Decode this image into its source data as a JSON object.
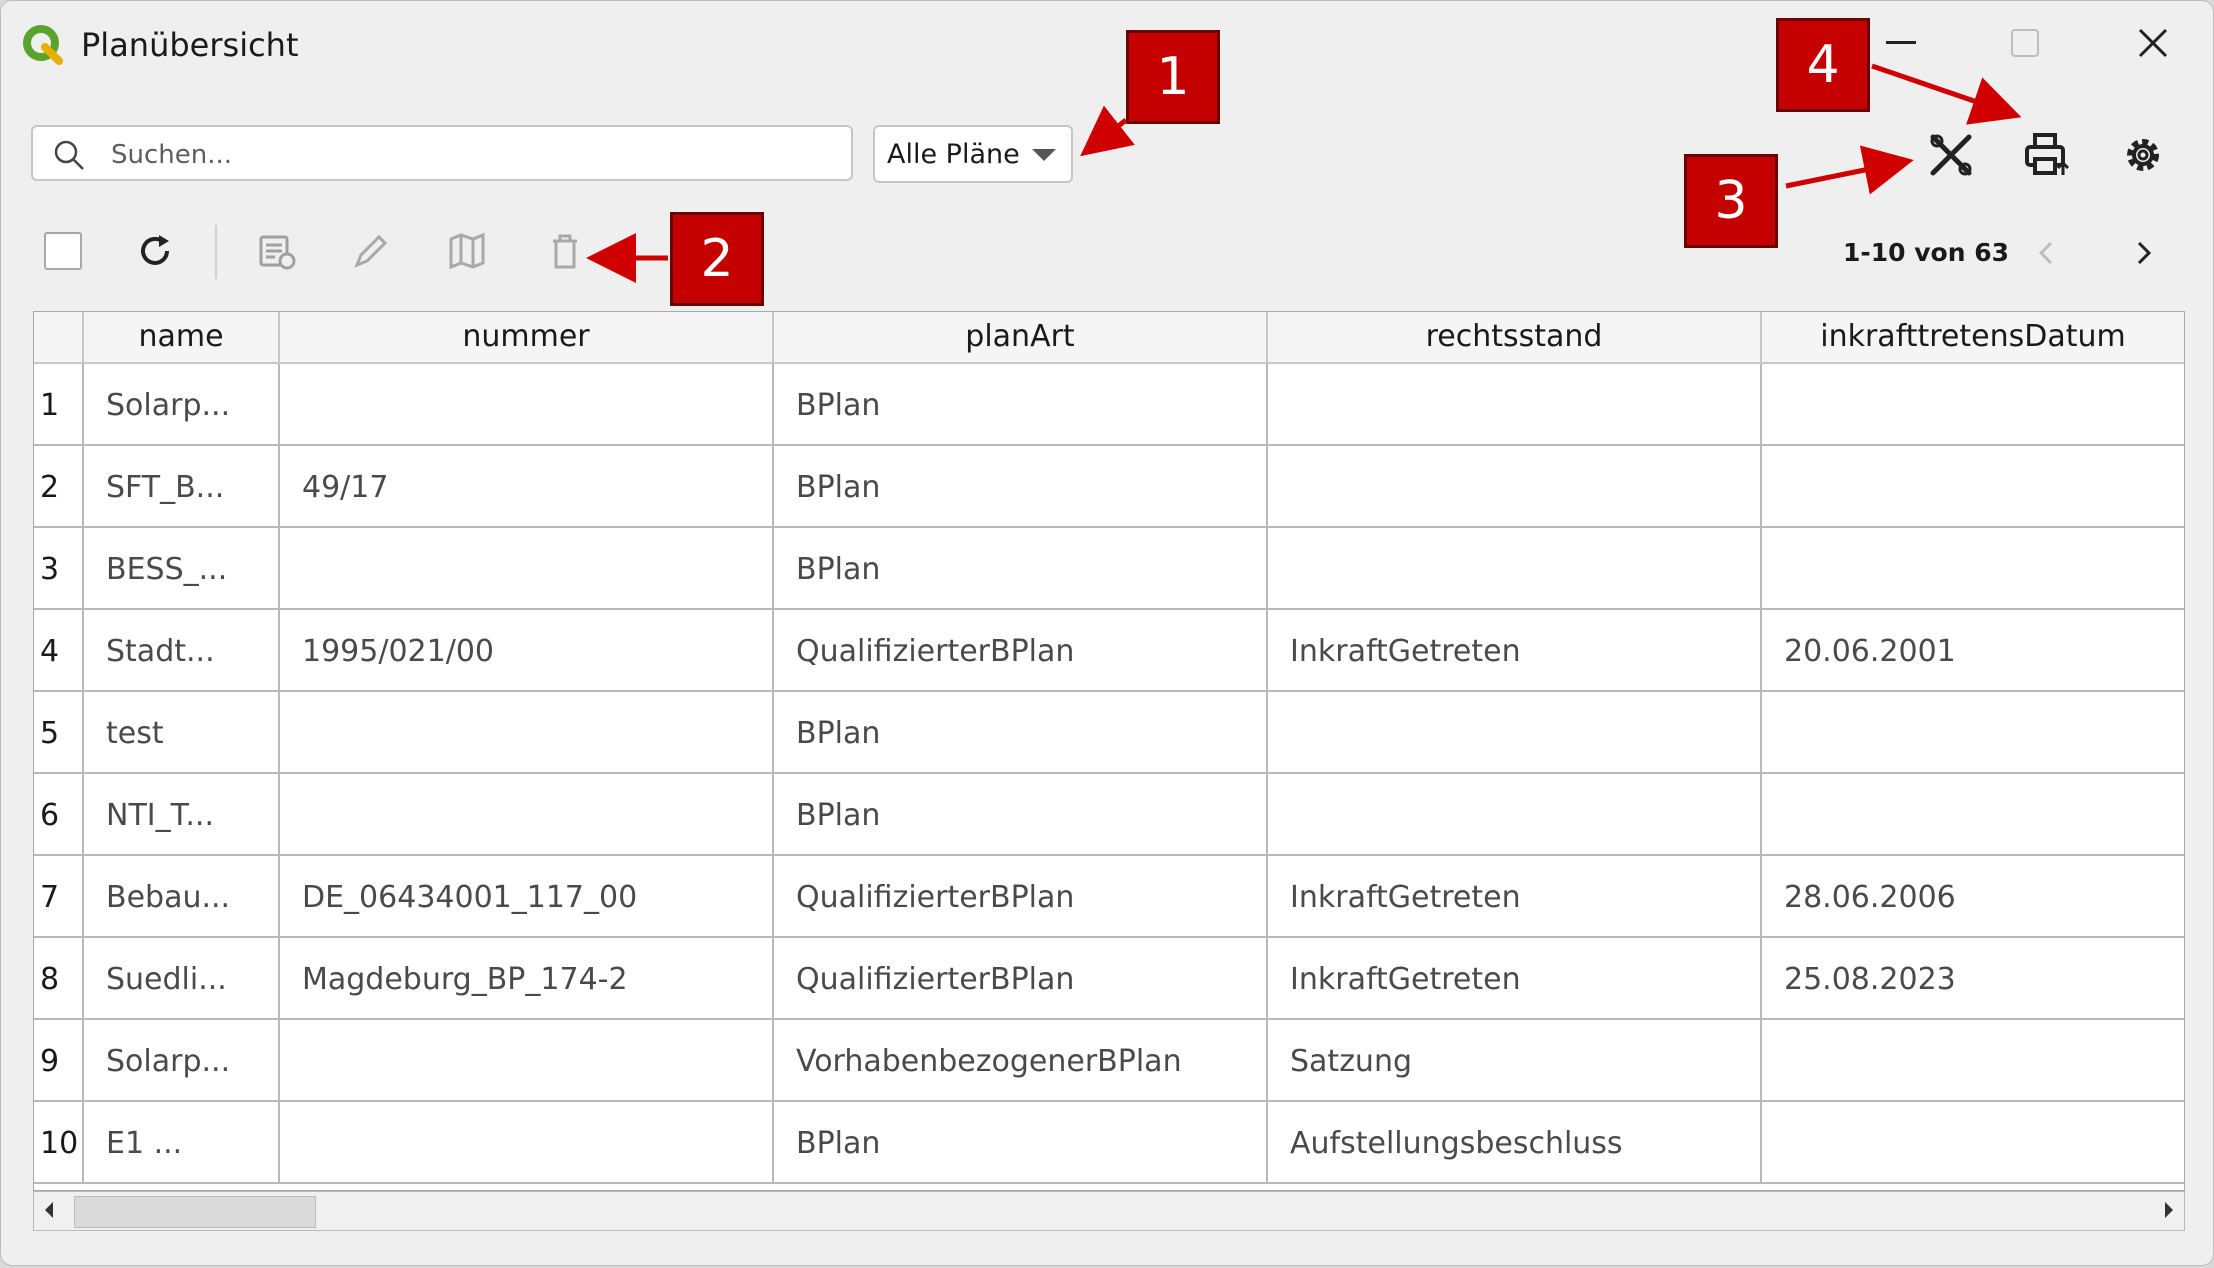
{
  "window": {
    "title": "Planübersicht",
    "controls": [
      "minimize",
      "maximize",
      "close"
    ]
  },
  "search": {
    "placeholder": "Suchen..."
  },
  "filter": {
    "selected": "Alle Pläne"
  },
  "toolbar": {
    "icons": [
      "select-all-checkbox-icon",
      "refresh-icon",
      "edit-attributes-icon",
      "pencil-icon",
      "map-icon",
      "trash-icon"
    ]
  },
  "top_actions": {
    "icons": [
      "tools-icon",
      "print-export-icon",
      "gear-icon"
    ]
  },
  "pager": {
    "text": "1-10 von 63"
  },
  "table": {
    "columns": [
      "name",
      "nummer",
      "planArt",
      "rechtsstand",
      "inkrafttretensDatum"
    ],
    "rows": [
      {
        "n": "1",
        "name": "Solarp...",
        "nummer": "",
        "planArt": "BPlan",
        "rechtsstand": "",
        "datum": ""
      },
      {
        "n": "2",
        "name": "SFT_B...",
        "nummer": "49/17",
        "planArt": "BPlan",
        "rechtsstand": "",
        "datum": ""
      },
      {
        "n": "3",
        "name": "BESS_...",
        "nummer": "",
        "planArt": "BPlan",
        "rechtsstand": "",
        "datum": ""
      },
      {
        "n": "4",
        "name": "Stadt...",
        "nummer": "1995/021/00",
        "planArt": "QualifizierterBPlan",
        "rechtsstand": "InkraftGetreten",
        "datum": "20.06.2001"
      },
      {
        "n": "5",
        "name": "test",
        "nummer": "",
        "planArt": "BPlan",
        "rechtsstand": "",
        "datum": ""
      },
      {
        "n": "6",
        "name": "NTI_T...",
        "nummer": "",
        "planArt": "BPlan",
        "rechtsstand": "",
        "datum": ""
      },
      {
        "n": "7",
        "name": "Bebau...",
        "nummer": "DE_06434001_117_00",
        "planArt": "QualifizierterBPlan",
        "rechtsstand": "InkraftGetreten",
        "datum": "28.06.2006"
      },
      {
        "n": "8",
        "name": "Suedli...",
        "nummer": "Magdeburg_BP_174-2",
        "planArt": "QualifizierterBPlan",
        "rechtsstand": "InkraftGetreten",
        "datum": "25.08.2023"
      },
      {
        "n": "9",
        "name": "Solarp...",
        "nummer": "",
        "planArt": "VorhabenbezogenerBPlan",
        "rechtsstand": "Satzung",
        "datum": ""
      },
      {
        "n": "10",
        "name": "E1 ...",
        "nummer": "",
        "planArt": "BPlan",
        "rechtsstand": "Aufstellungsbeschluss",
        "datum": ""
      }
    ]
  },
  "callouts": [
    "1",
    "2",
    "3",
    "4"
  ],
  "colors": {
    "callout": "#c40000",
    "arrow": "#d00000"
  }
}
